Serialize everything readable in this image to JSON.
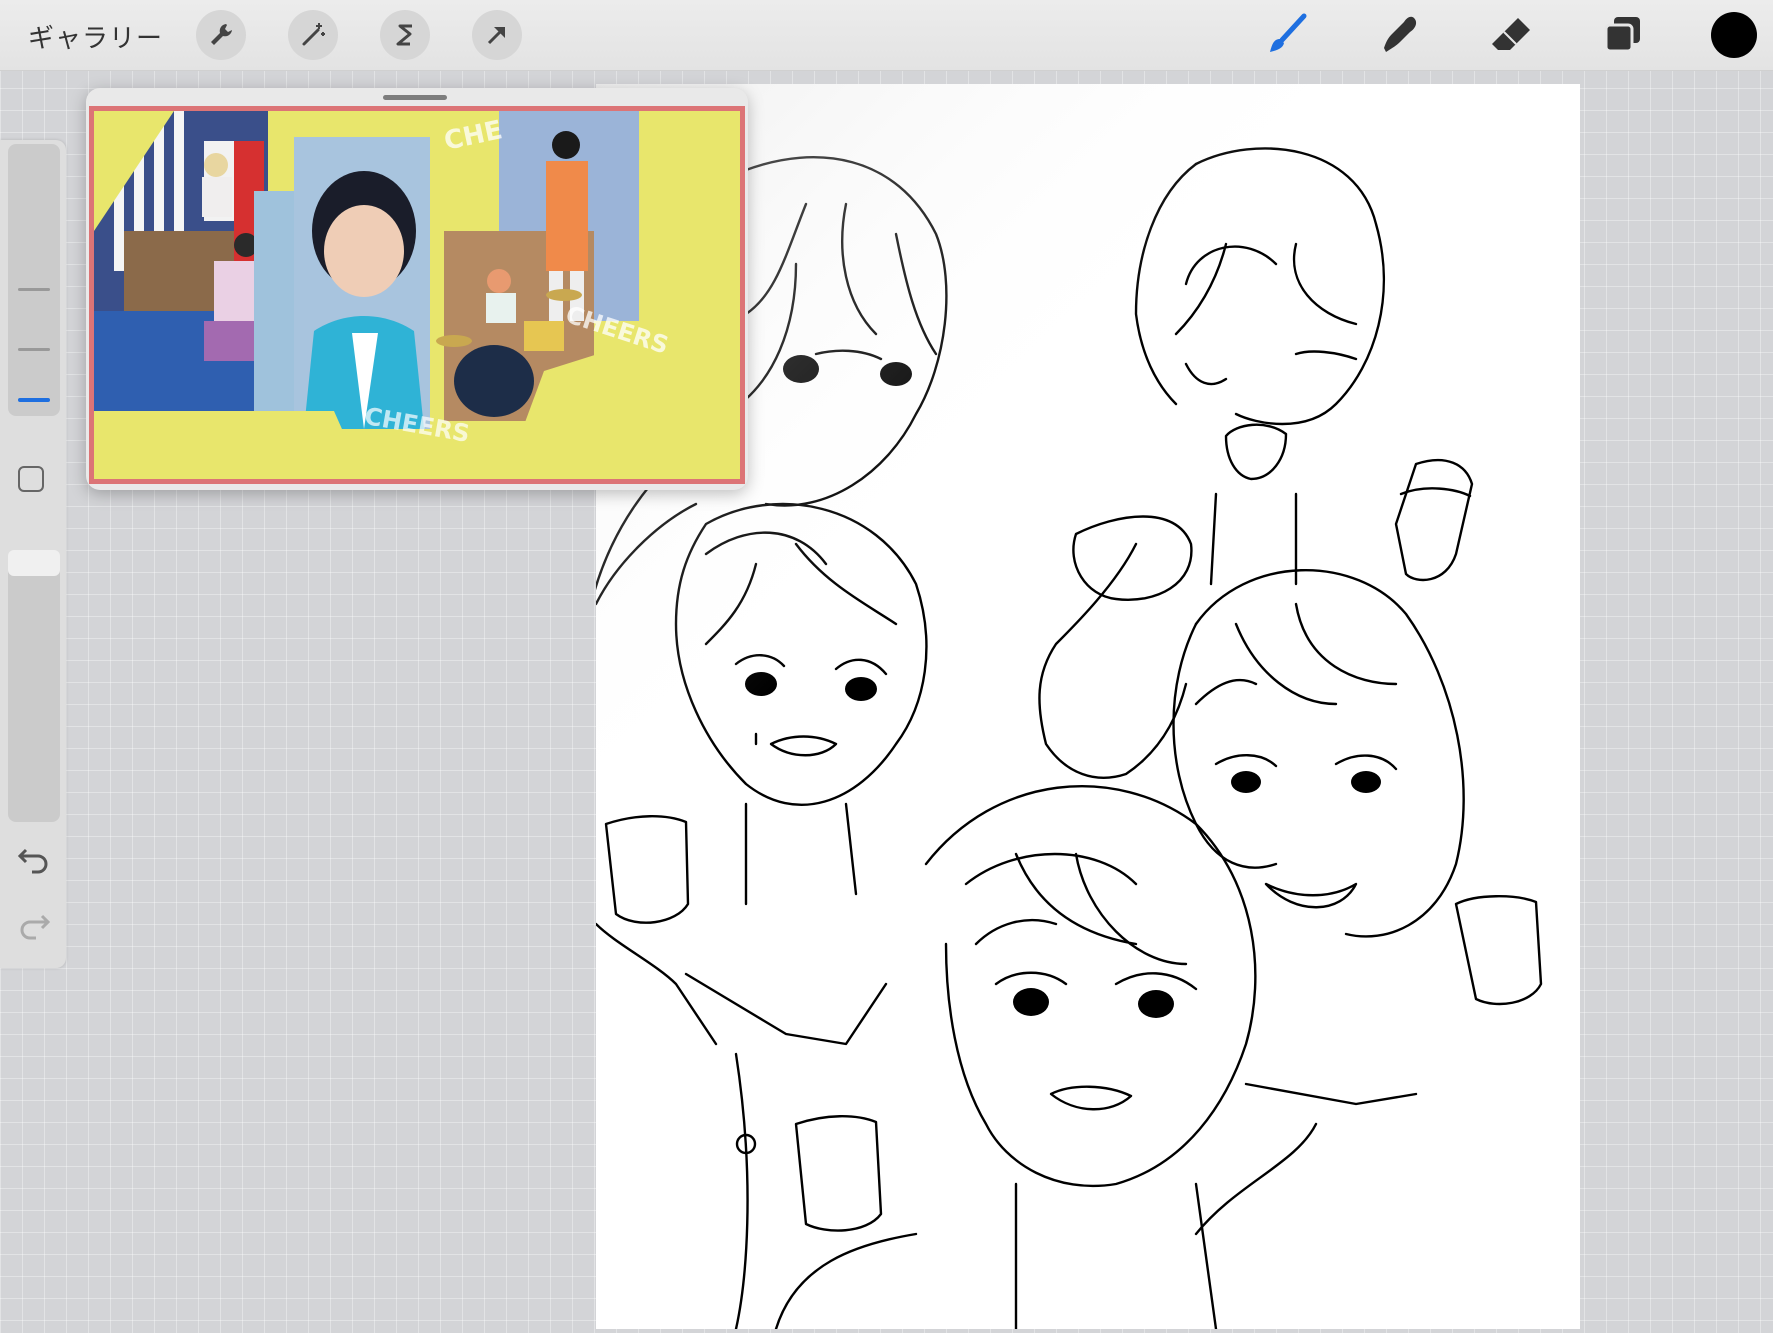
{
  "toolbar": {
    "gallery_label": "ギャラリー",
    "left_tools": [
      {
        "name": "actions-wrench-icon"
      },
      {
        "name": "adjustments-magic-wand-icon"
      },
      {
        "name": "selection-s-icon"
      },
      {
        "name": "transform-arrow-icon"
      }
    ],
    "right_tools": [
      {
        "name": "brush-icon",
        "active": true
      },
      {
        "name": "smudge-icon"
      },
      {
        "name": "eraser-icon"
      },
      {
        "name": "layers-icon"
      }
    ],
    "current_color": "#000000",
    "active_accent": "#1e6fe0"
  },
  "reference": {
    "overlay_text": [
      "CHE",
      "CHEERS",
      "CHEERS"
    ]
  }
}
